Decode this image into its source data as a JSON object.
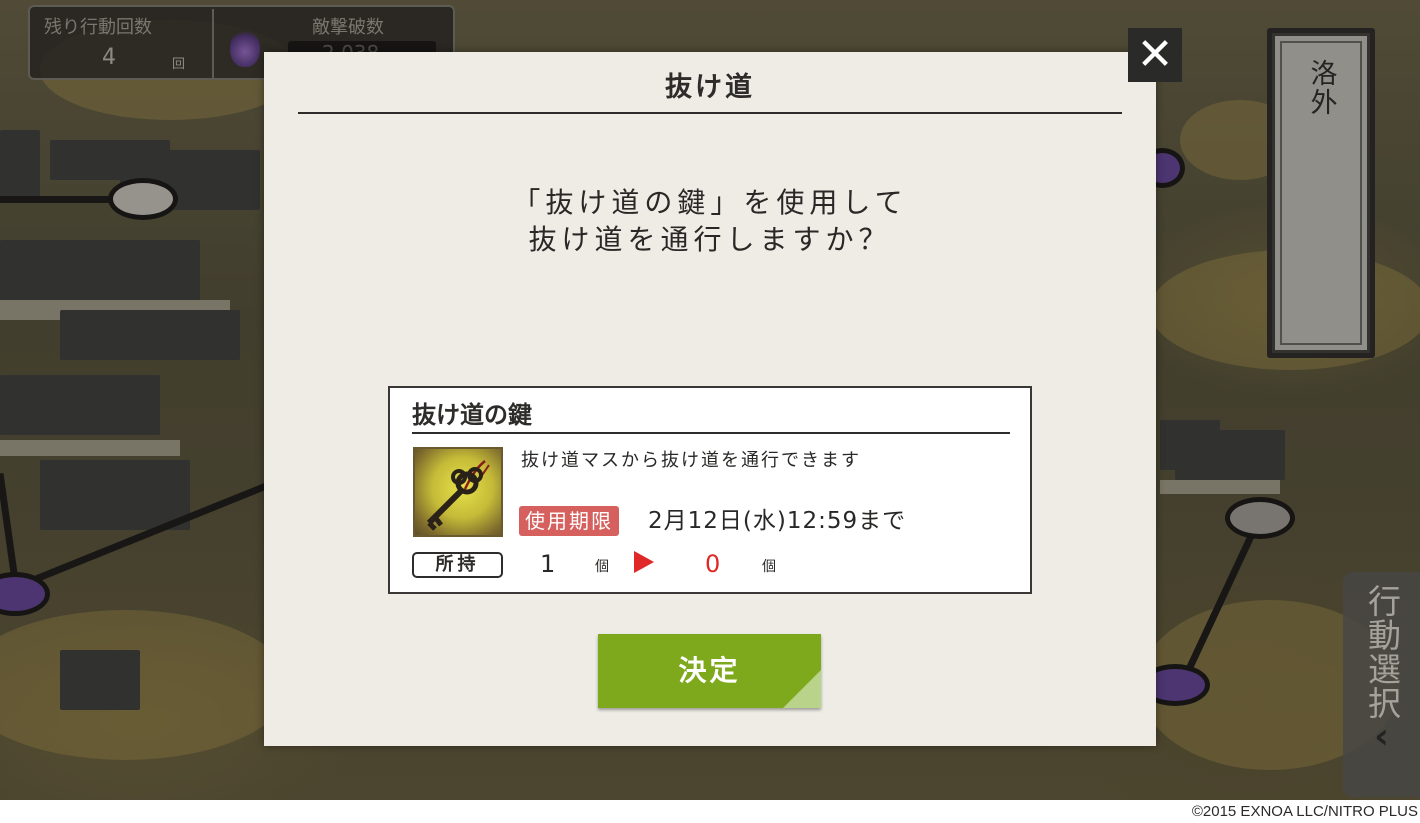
{
  "hud": {
    "remaining_actions_label": "残り行動回数",
    "remaining_actions_value": "4",
    "remaining_actions_unit": "回",
    "enemies_defeated_label": "敵撃破数",
    "enemies_defeated_value": "2,038"
  },
  "area": {
    "name": "洛外"
  },
  "action_tab": {
    "label": "行動選択",
    "chevron": "‹"
  },
  "dialog": {
    "title": "抜け道",
    "message_line1": "「抜け道の鍵」を使用して",
    "message_line2": "抜け道を通行しますか？",
    "close_symbol": "✕",
    "item": {
      "name": "抜け道の鍵",
      "icon": "key-icon",
      "description": "抜け道マスから抜け道を通行できます",
      "expiry_label": "使用期限",
      "expiry_value": "2月12日(水)12:59まで",
      "owned_label": "所持",
      "owned_current": "1",
      "owned_unit": "個",
      "owned_after": "0",
      "owned_after_unit": "個"
    },
    "confirm_label": "決定"
  },
  "copyright": "©2015 EXNOA LLC/NITRO PLUS",
  "colors": {
    "confirm_button": "#7fa91c",
    "expiry_badge": "#d6605e",
    "after_value": "#e02828",
    "dialog_bg": "#efece6"
  }
}
